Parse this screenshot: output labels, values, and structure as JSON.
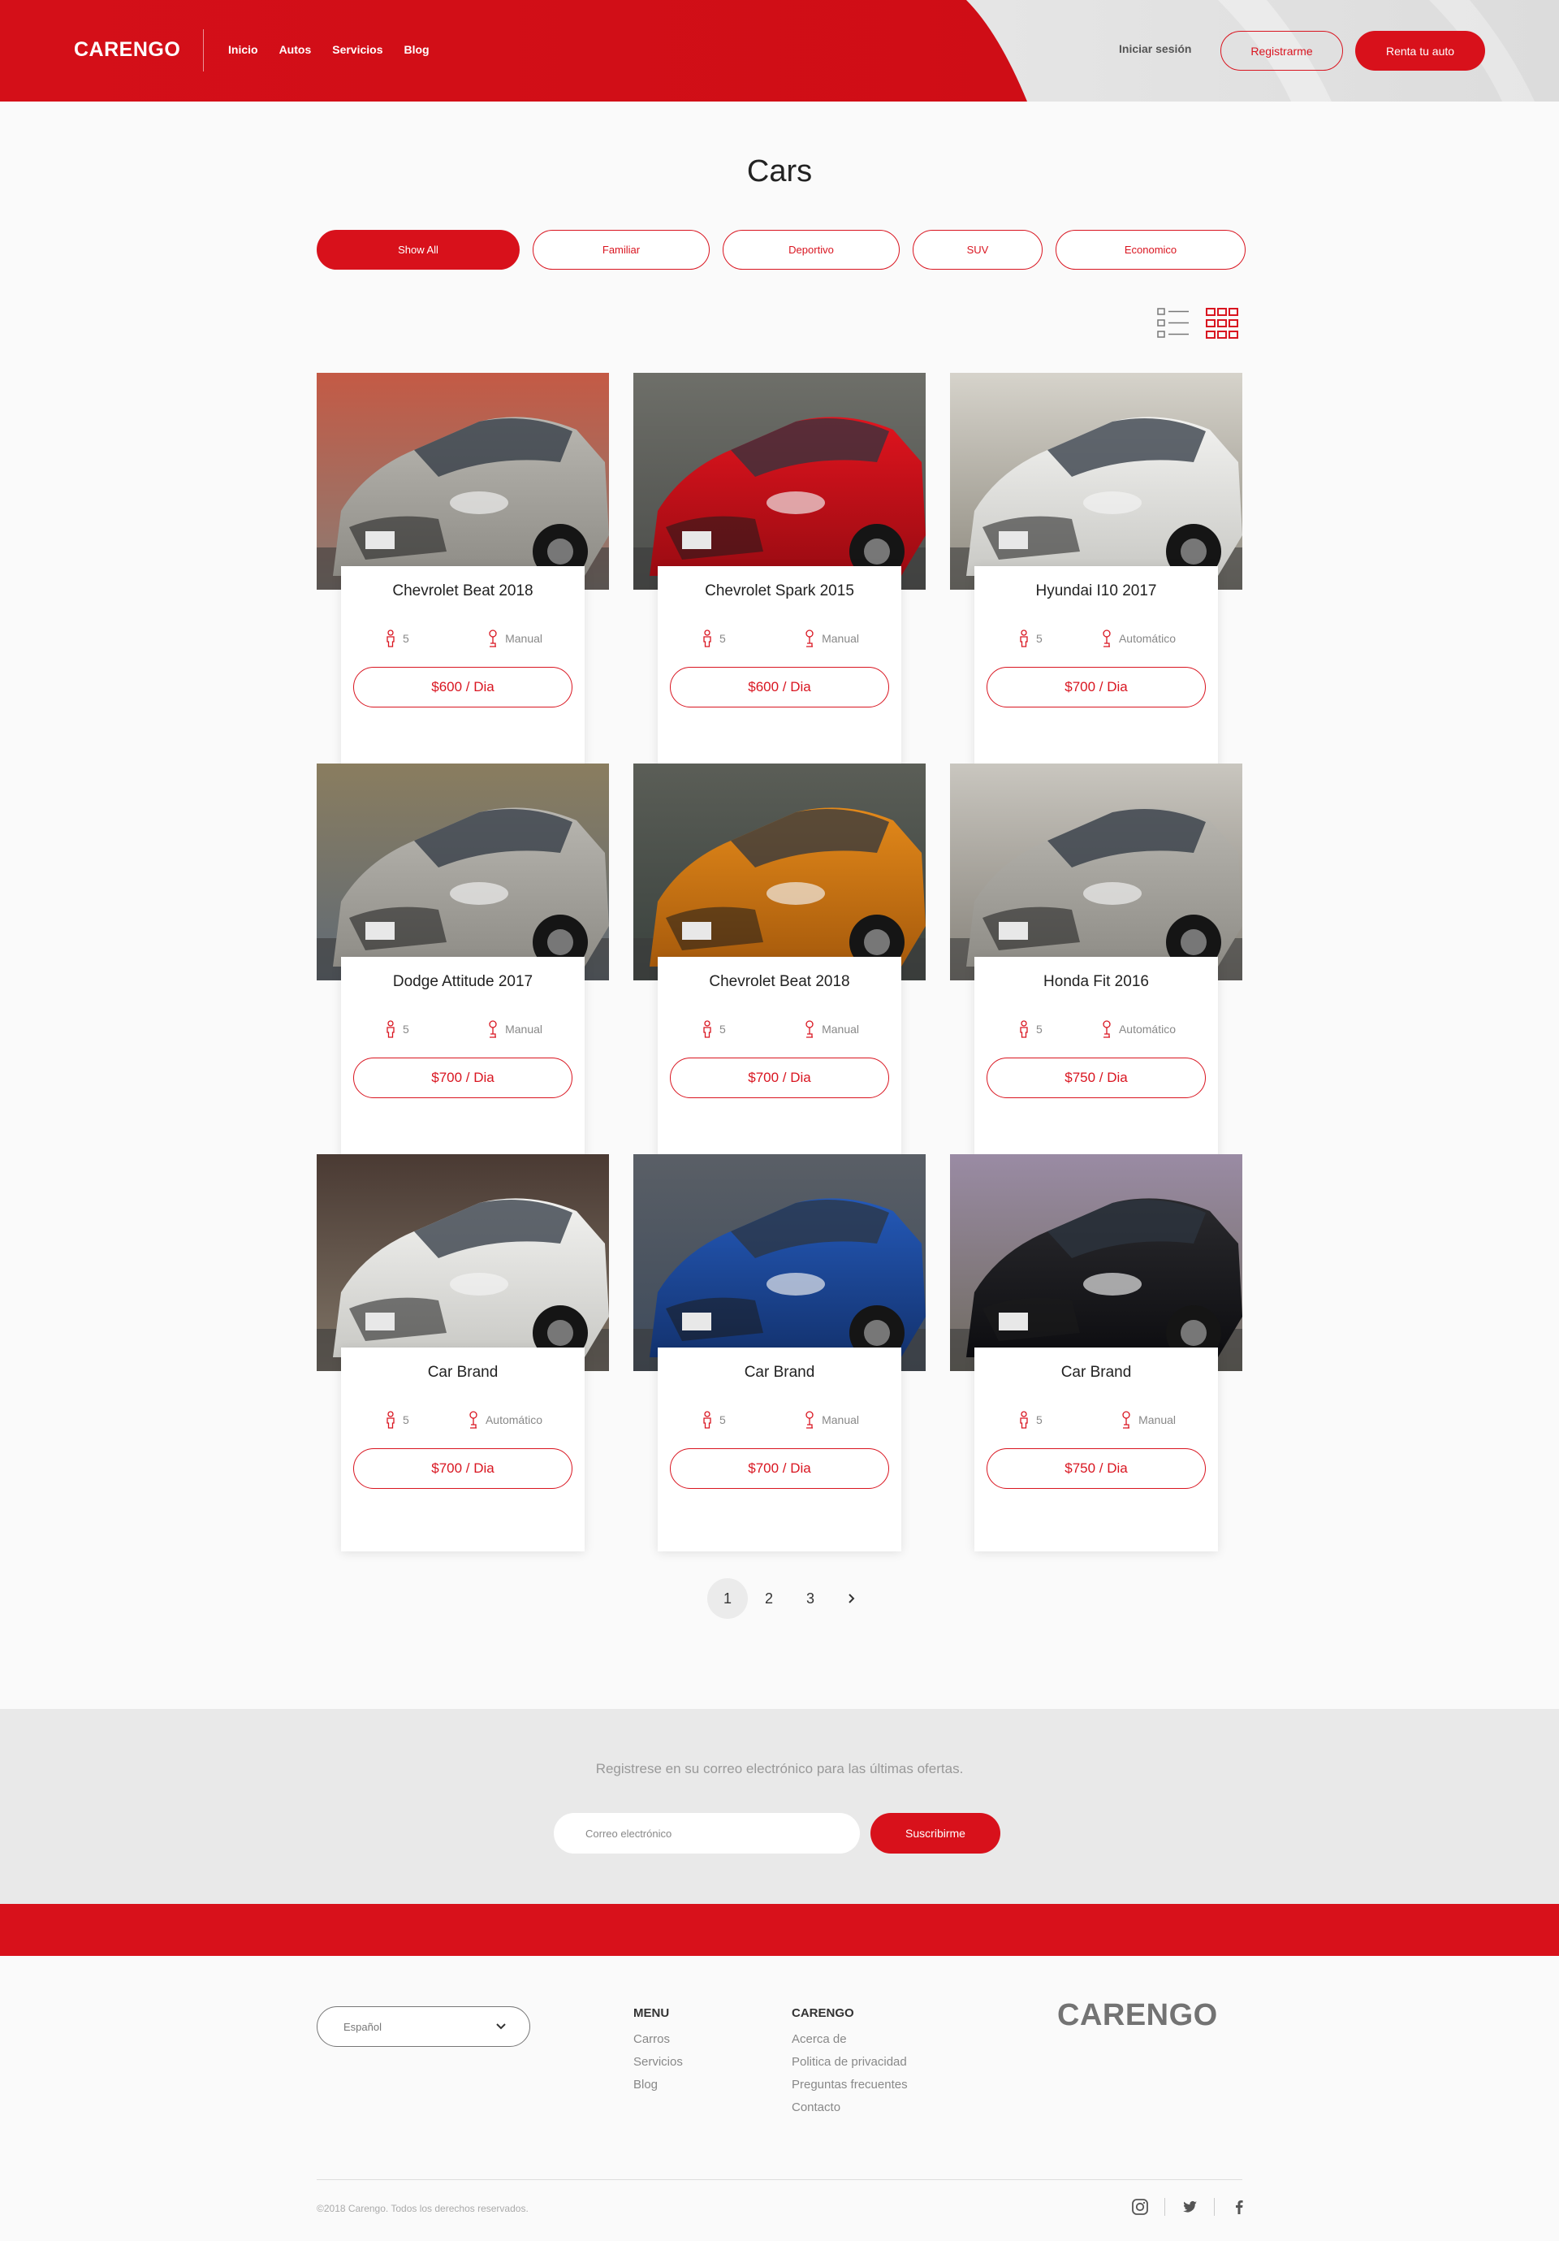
{
  "header": {
    "logo": "CARENGO",
    "nav": [
      "Inicio",
      "Autos",
      "Servicios",
      "Blog"
    ],
    "login": "Iniciar sesión",
    "register": "Registrarme",
    "rent": "Renta tu auto",
    "brand_color": "#d8111b"
  },
  "main": {
    "title": "Cars",
    "filters": [
      "Show All",
      "Familiar",
      "Deportivo",
      "SUV",
      "Economico"
    ],
    "active_filter": "Show All",
    "view_modes": [
      "list-view-icon",
      "grid-view-icon"
    ],
    "cars": [
      {
        "name": "Chevrolet Beat 2018",
        "seats": "5",
        "transmission": "Manual",
        "price": "$600 / Dia",
        "color": "silver"
      },
      {
        "name": "Chevrolet Spark 2015",
        "seats": "5",
        "transmission": "Manual",
        "price": "$600 / Dia",
        "color": "red"
      },
      {
        "name": "Hyundai I10 2017",
        "seats": "5",
        "transmission": "Automático",
        "price": "$700 / Dia",
        "color": "white"
      },
      {
        "name": "Dodge Attitude 2017",
        "seats": "5",
        "transmission": "Manual",
        "price": "$700 / Dia",
        "color": "silver"
      },
      {
        "name": "Chevrolet Beat 2018",
        "seats": "5",
        "transmission": "Manual",
        "price": "$700 / Dia",
        "color": "orange"
      },
      {
        "name": "Honda Fit 2016",
        "seats": "5",
        "transmission": "Automático",
        "price": "$750 / Dia",
        "color": "silver"
      },
      {
        "name": "Car Brand",
        "seats": "5",
        "transmission": "Automático",
        "price": "$700 / Dia",
        "color": "white"
      },
      {
        "name": "Car Brand",
        "seats": "5",
        "transmission": "Manual",
        "price": "$700 / Dia",
        "color": "blue"
      },
      {
        "name": "Car Brand",
        "seats": "5",
        "transmission": "Manual",
        "price": "$750 / Dia",
        "color": "black"
      }
    ],
    "pagination": [
      "1",
      "2",
      "3"
    ],
    "current_page": "1"
  },
  "newsletter": {
    "text": "Registrese en su correo electrónico para las últimas ofertas.",
    "placeholder": "Correo electrónico",
    "button": "Suscribirme"
  },
  "footer": {
    "language": "Español",
    "menu_title": "MENU",
    "menu_items": [
      "Carros",
      "Servicios",
      "Blog"
    ],
    "company_title": "CARENGO",
    "company_items": [
      "Acerca de",
      "Politica de privacidad",
      "Preguntas frecuentes",
      "Contacto"
    ],
    "logo": "CARENGO",
    "copyright": "©2018 Carengo. Todos los derechos reservados.",
    "socials": [
      "instagram-icon",
      "twitter-icon",
      "facebook-icon"
    ]
  }
}
